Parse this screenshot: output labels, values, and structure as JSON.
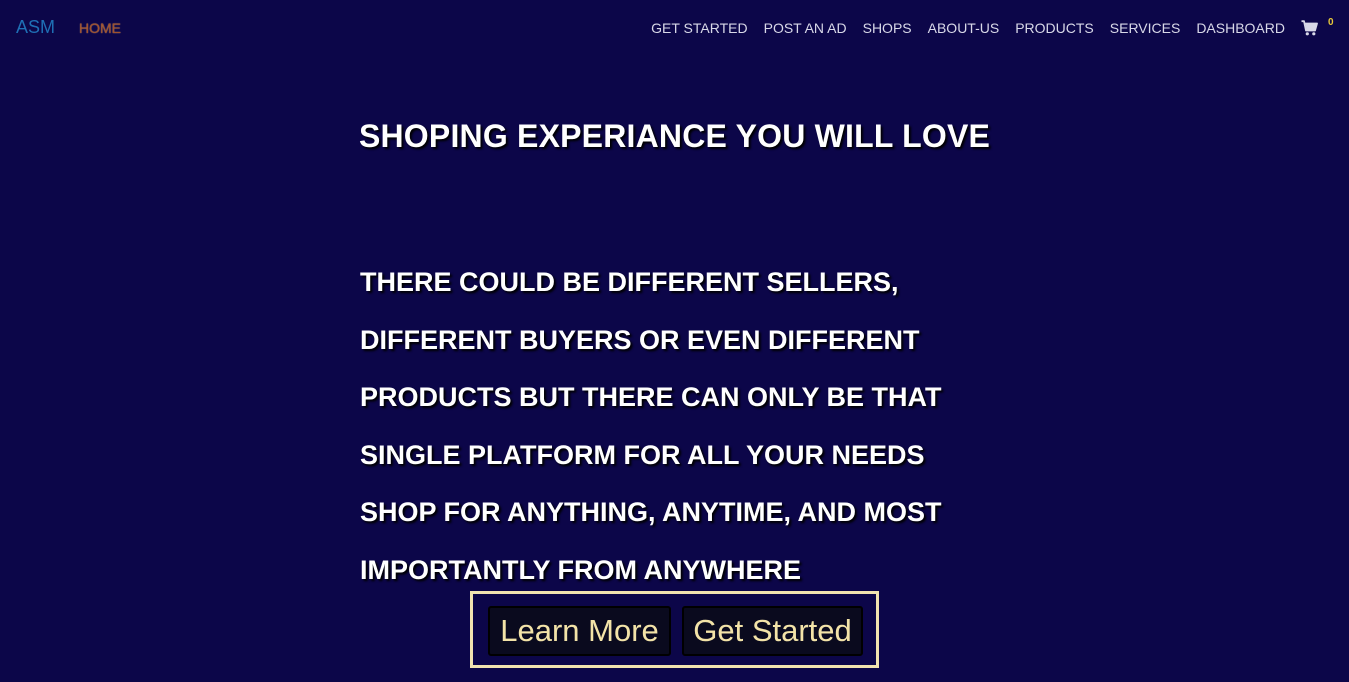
{
  "navbar": {
    "brand": "ASM",
    "home": "HOME",
    "items": [
      {
        "label": "GET STARTED"
      },
      {
        "label": "POST AN AD"
      },
      {
        "label": "SHOPS"
      },
      {
        "label": "ABOUT-US"
      },
      {
        "label": "PRODUCTS"
      },
      {
        "label": "SERVICES"
      },
      {
        "label": "DASHBOARD"
      }
    ],
    "cart": {
      "icon": "shopping-cart-icon",
      "count": "0"
    }
  },
  "hero": {
    "title": "SHOPING EXPERIANCE YOU WILL LOVE",
    "text": "THERE COULD BE DIFFERENT SELLERS, DIFFERENT BUYERS OR EVEN DIFFERENT PRODUCTS BUT THERE CAN ONLY BE THAT SINGLE PLATFORM FOR ALL YOUR NEEDS SHOP FOR ANYTHING, ANYTIME, AND MOST IMPORTANTLY FROM ANYWHERE",
    "learn_more": "Learn More",
    "get_started": "Get Started"
  },
  "colors": {
    "background": "#0c0649",
    "brand": "#1f6fb5",
    "home": "#a0522d",
    "button_text": "#f3e3a8",
    "frame": "#f1e3b0",
    "cart_badge": "#e8c93a"
  }
}
